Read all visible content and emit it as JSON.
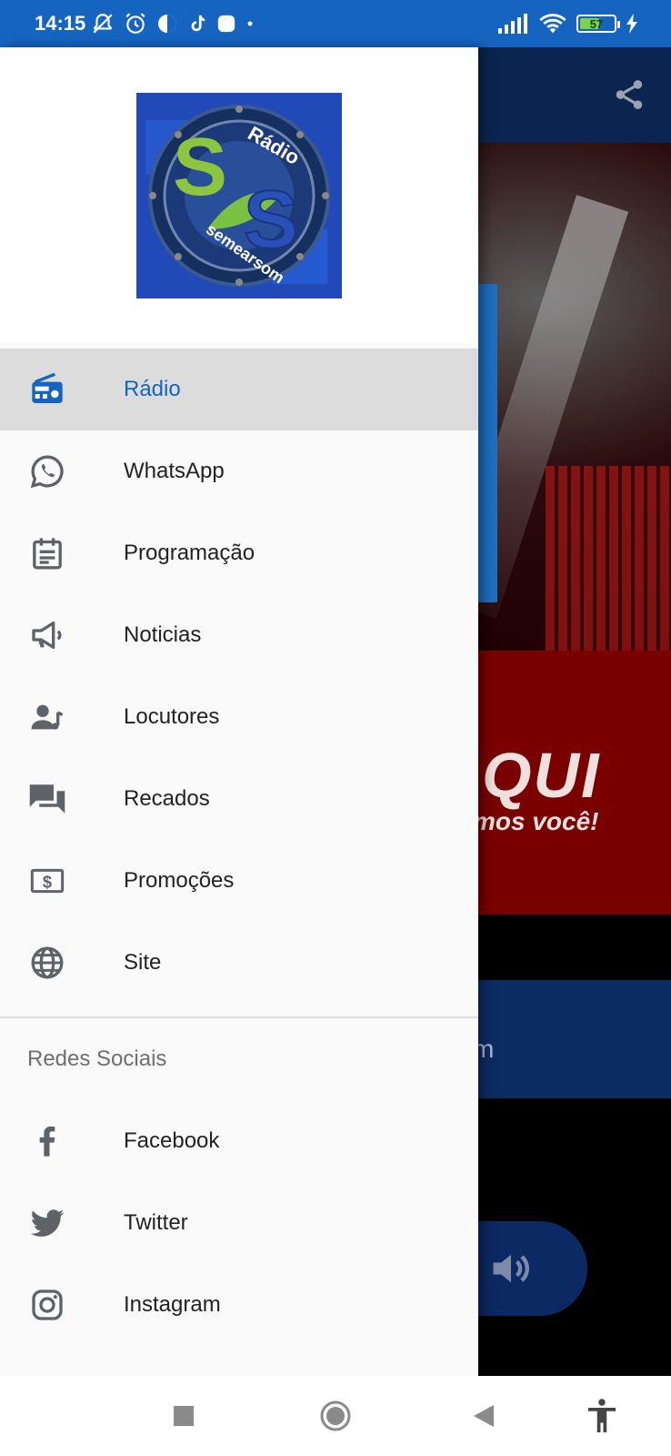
{
  "status": {
    "time": "14:15",
    "battery": "57",
    "battery_level": 0.57
  },
  "drawer": {
    "logo": {
      "text_radio": "Rádio",
      "text_name": "semearsom",
      "letters": "SS"
    },
    "menu": [
      {
        "label": "Rádio",
        "icon": "radio-icon",
        "active": true
      },
      {
        "label": "WhatsApp",
        "icon": "whatsapp-icon",
        "active": false
      },
      {
        "label": "Programação",
        "icon": "calendar-icon",
        "active": false
      },
      {
        "label": "Noticias",
        "icon": "megaphone-icon",
        "active": false
      },
      {
        "label": "Locutores",
        "icon": "announcer-icon",
        "active": false
      },
      {
        "label": "Recados",
        "icon": "chat-icon",
        "active": false
      },
      {
        "label": "Promoções",
        "icon": "money-icon",
        "active": false
      },
      {
        "label": "Site",
        "icon": "globe-icon",
        "active": false
      }
    ],
    "section_title": "Redes Sociais",
    "social": [
      {
        "label": "Facebook",
        "icon": "facebook-icon"
      },
      {
        "label": "Twitter",
        "icon": "twitter-icon"
      },
      {
        "label": "Instagram",
        "icon": "instagram-icon"
      }
    ]
  },
  "background_app": {
    "banner_big": "QUI",
    "banner_small": "mos você!",
    "band_text": "m"
  },
  "colors": {
    "accent": "#1565c0",
    "drawer_bg": "#fafafa",
    "active_item_bg": "#dcdcdc"
  }
}
